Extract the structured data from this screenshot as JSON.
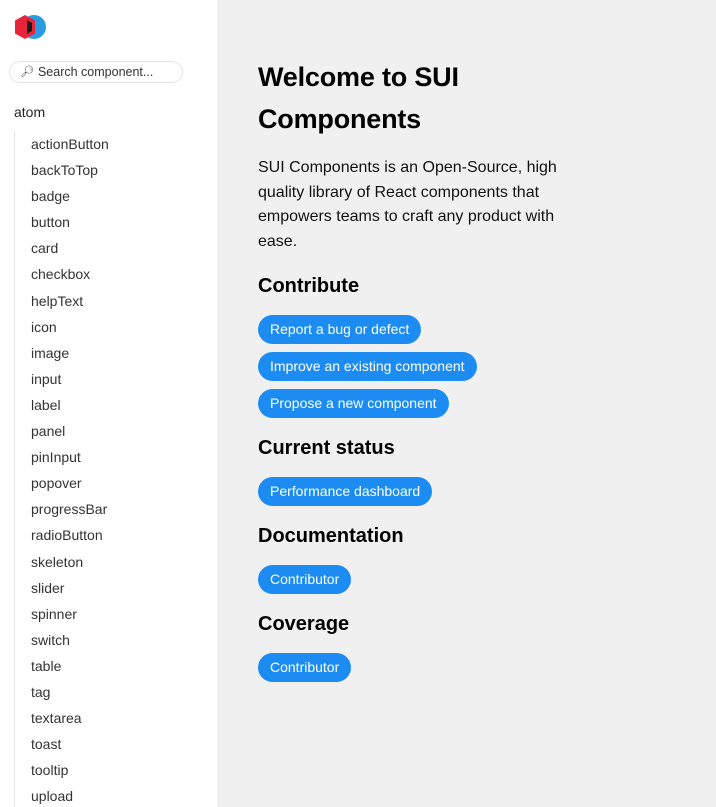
{
  "sidebar": {
    "logo_icon": "sui-logo-icon",
    "search": {
      "icon": "magnifier-icon",
      "placeholder": "Search component..."
    },
    "group_title": "atom",
    "items": [
      "actionButton",
      "backToTop",
      "badge",
      "button",
      "card",
      "checkbox",
      "helpText",
      "icon",
      "image",
      "input",
      "label",
      "panel",
      "pinInput",
      "popover",
      "progressBar",
      "radioButton",
      "skeleton",
      "slider",
      "spinner",
      "switch",
      "table",
      "tag",
      "textarea",
      "toast",
      "tooltip",
      "upload"
    ]
  },
  "main": {
    "title": "Welcome to SUI Components",
    "intro": "SUI Components is an Open-Source, high quality library of React components that empowers teams to craft any product with ease.",
    "contribute": {
      "heading": "Contribute",
      "buttons": [
        "Report a bug or defect",
        "Improve an existing component",
        "Propose a new component"
      ]
    },
    "status": {
      "heading": "Current status",
      "buttons": [
        "Performance dashboard"
      ]
    },
    "documentation": {
      "heading": "Documentation",
      "buttons": [
        "Contributor"
      ]
    },
    "coverage": {
      "heading": "Coverage",
      "buttons": [
        "Contributor"
      ]
    }
  },
  "colors": {
    "accent": "#1c8cf2",
    "main_background": "#f0f0f0",
    "logo_red": "#e8243c",
    "logo_blue": "#2a9be0"
  }
}
